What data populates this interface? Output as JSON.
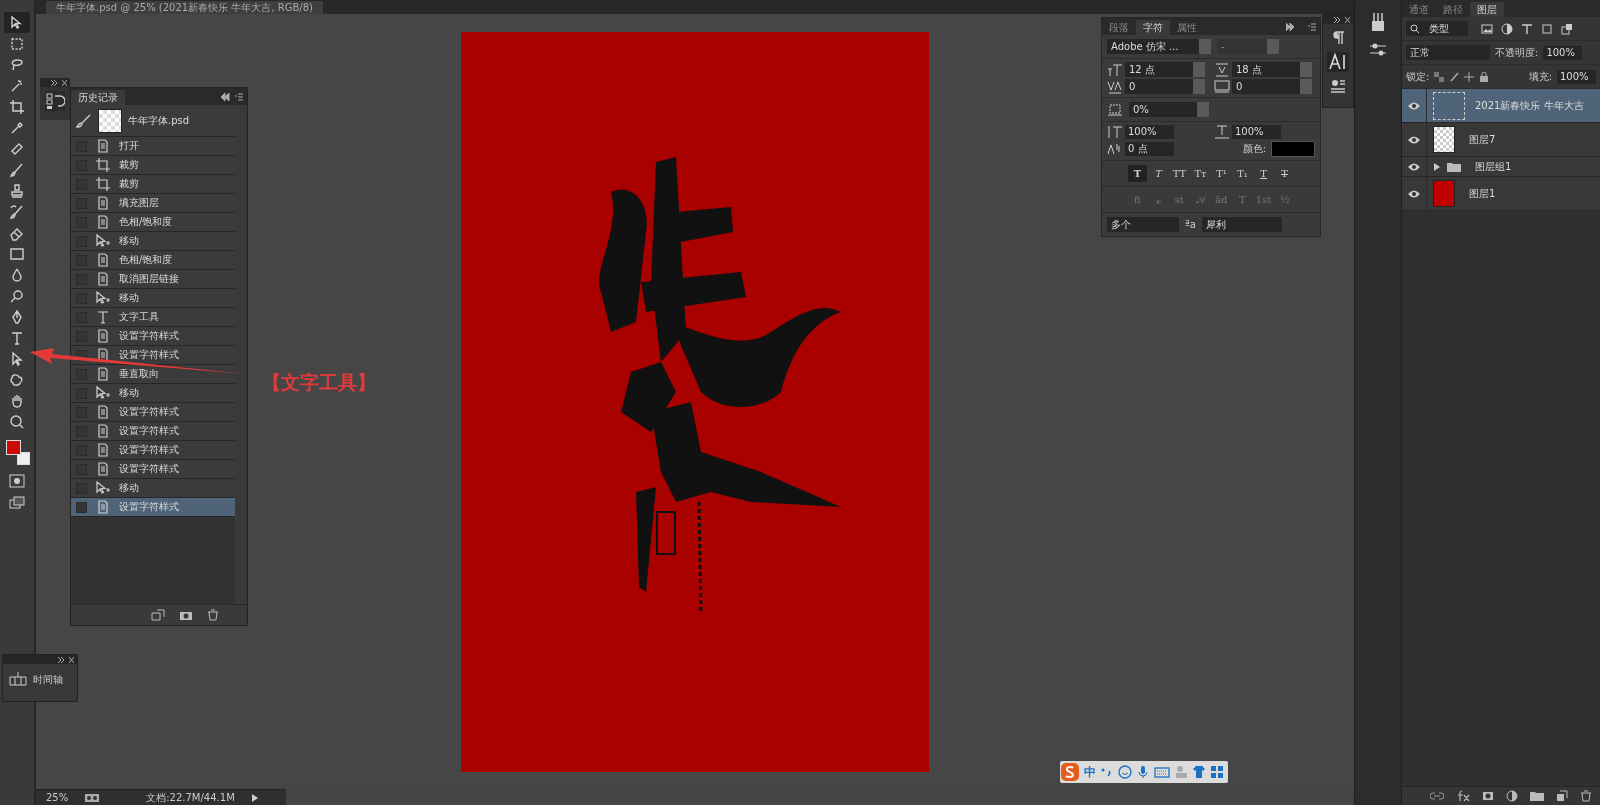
{
  "document_tab": {
    "title": "牛年字体.psd @ 25% (2021新春快乐 牛年大吉, RGB/8)"
  },
  "toolbar": {
    "tools": [
      {
        "kind": "move",
        "selected": true
      },
      {
        "kind": "marquee",
        "selected": false
      },
      {
        "kind": "lasso",
        "selected": false
      },
      {
        "kind": "wand",
        "selected": false
      },
      {
        "kind": "crop",
        "selected": false
      },
      {
        "kind": "eyedropper",
        "selected": false
      },
      {
        "kind": "heal",
        "selected": false
      },
      {
        "kind": "brush",
        "selected": false
      },
      {
        "kind": "stamp",
        "selected": false
      },
      {
        "kind": "history_brush",
        "selected": false
      },
      {
        "kind": "eraser",
        "selected": false
      },
      {
        "kind": "gradient",
        "selected": false
      },
      {
        "kind": "blur",
        "selected": false
      },
      {
        "kind": "dodge",
        "selected": false
      },
      {
        "kind": "pen",
        "selected": false
      },
      {
        "kind": "type",
        "selected": false
      },
      {
        "kind": "path_select",
        "selected": false
      },
      {
        "kind": "shape",
        "selected": false
      },
      {
        "kind": "hand",
        "selected": false
      },
      {
        "kind": "zoom",
        "selected": false
      }
    ],
    "swatches": [
      {
        "color": "#cc0a0a"
      },
      {
        "color": "#eeeeee"
      }
    ]
  },
  "history_panel": {
    "title": "历史记录",
    "snapshot": "牛年字体.psd",
    "items": [
      {
        "label": "打开",
        "kind": "document",
        "selected": false
      },
      {
        "label": "裁剪",
        "kind": "crop",
        "selected": false
      },
      {
        "label": "裁剪",
        "kind": "crop",
        "selected": false
      },
      {
        "label": "填充图层",
        "kind": "document",
        "selected": false
      },
      {
        "label": "色相/饱和度",
        "kind": "document",
        "selected": false
      },
      {
        "label": "移动",
        "kind": "move",
        "selected": false
      },
      {
        "label": "色相/饱和度",
        "kind": "document",
        "selected": false
      },
      {
        "label": "取消图层链接",
        "kind": "document",
        "selected": false
      },
      {
        "label": "移动",
        "kind": "move",
        "selected": false
      },
      {
        "label": "文字工具",
        "kind": "type",
        "selected": false
      },
      {
        "label": "设置字符样式",
        "kind": "document",
        "selected": false
      },
      {
        "label": "设置字符样式",
        "kind": "document",
        "selected": false
      },
      {
        "label": "垂直取向",
        "kind": "document",
        "selected": false
      },
      {
        "label": "移动",
        "kind": "move",
        "selected": false
      },
      {
        "label": "设置字符样式",
        "kind": "document",
        "selected": false
      },
      {
        "label": "设置字符样式",
        "kind": "document",
        "selected": false
      },
      {
        "label": "设置字符样式",
        "kind": "document",
        "selected": false
      },
      {
        "label": "设置字符样式",
        "kind": "document",
        "selected": false
      },
      {
        "label": "移动",
        "kind": "move",
        "selected": false
      },
      {
        "label": "设置字符样式",
        "kind": "document",
        "selected": true
      }
    ]
  },
  "character_panel": {
    "tabs": [
      {
        "label": "段落",
        "selected": false
      },
      {
        "label": "字符",
        "selected": true
      },
      {
        "label": "属性",
        "selected": false
      }
    ],
    "font_family": "Adobe 仿宋 ...",
    "font_style": "-",
    "font_size": "12 点",
    "leading": "18 点",
    "kerning": "0",
    "tracking": "0",
    "tsume": "0%",
    "vertical_scale": "100%",
    "horizontal_scale": "100%",
    "baseline_shift": "0 点",
    "color_label": "颜色:",
    "style_buttons": [
      {
        "label": "T",
        "kind": "bold",
        "selected": true
      },
      {
        "label": "T",
        "kind": "italic",
        "selected": false
      },
      {
        "label": "TT",
        "kind": "caps",
        "selected": false
      },
      {
        "label": "Tт",
        "kind": "small_caps",
        "selected": false
      },
      {
        "label": "T¹",
        "kind": "superscript",
        "selected": false
      },
      {
        "label": "T₁",
        "kind": "subscript",
        "selected": false
      },
      {
        "label": "T",
        "kind": "underline",
        "selected": false
      },
      {
        "label": "T",
        "kind": "strikethrough",
        "selected": false
      }
    ],
    "opentype_buttons": [
      "fi",
      "ℴ",
      "st",
      "𝒜",
      "ād",
      "T",
      "1st",
      "½"
    ],
    "language": "多个",
    "antialias_icon": "ªa",
    "antialias": "犀利"
  },
  "layers_panel": {
    "tabs": [
      {
        "label": "通道",
        "selected": false
      },
      {
        "label": "路径",
        "selected": false
      },
      {
        "label": "图层",
        "selected": true
      }
    ],
    "filter": "类型",
    "blend_mode": "正常",
    "opacity_label": "不透明度:",
    "opacity": "100%",
    "lock_label": "锁定:",
    "fill_label": "填充:",
    "fill": "100%",
    "layers": [
      {
        "name": "2021新春快乐 牛年大吉",
        "kind": "text",
        "visible": true,
        "selected": true
      },
      {
        "name": "图层7",
        "kind": "transparent",
        "visible": true,
        "selected": false
      },
      {
        "name": "图层组1",
        "kind": "group",
        "visible": true,
        "selected": false
      },
      {
        "name": "图层1",
        "kind": "fill",
        "visible": true,
        "selected": false
      }
    ]
  },
  "timeline_panel": {
    "label": "时间轴"
  },
  "status_bar": {
    "zoom": "25%",
    "document": "文档:22.7M/44.1M"
  },
  "ime_toolbar": {
    "mode": "中"
  },
  "annotation": {
    "label": "【文字工具】"
  }
}
